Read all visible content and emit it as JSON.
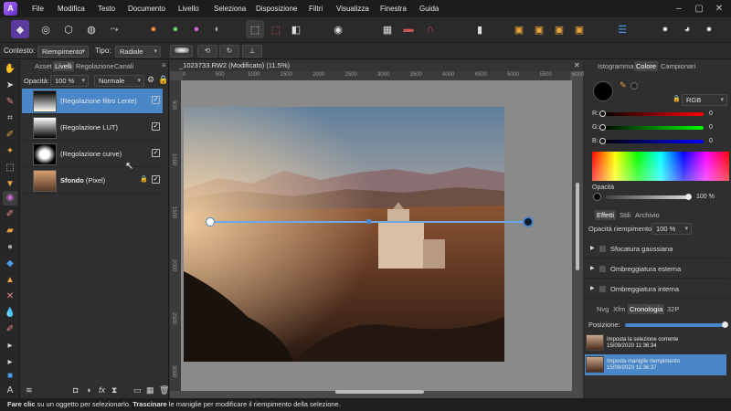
{
  "menubar": {
    "items": [
      "File",
      "Modifica",
      "Testo",
      "Documento",
      "Livello",
      "Seleziona",
      "Disposizione",
      "Filtri",
      "Visualizza",
      "Finestra",
      "Guida"
    ]
  },
  "context": {
    "context_label": "Contesto:",
    "context_value": "Riempimento",
    "type_label": "Tipo:",
    "type_value": "Radiale"
  },
  "layers_panel": {
    "tabs": [
      "Asset",
      "Livelli",
      "Regolazione",
      "Canali"
    ],
    "opacity_label": "Opacità:",
    "opacity_value": "100 %",
    "blend_mode": "Normale",
    "layers": [
      {
        "name": "(Regolazione filtro Lente)"
      },
      {
        "name": "(Regolazione LUT)"
      },
      {
        "name": "(Regolazione curve)"
      },
      {
        "name": "Sfondo",
        "suffix": "(Pixel)"
      }
    ]
  },
  "document": {
    "tab_title": "_1023733.RW2 (Modificato) (11.5%)",
    "ruler_h": [
      "0",
      "500",
      "1000",
      "1500",
      "2000",
      "2500",
      "3000",
      "3500",
      "4000",
      "4500",
      "5000",
      "5500",
      "6000"
    ],
    "ruler_v": [
      "500",
      "1000",
      "1500",
      "2000",
      "2500",
      "3000"
    ]
  },
  "right_panel": {
    "top_tabs": [
      "Istogramma",
      "Colore",
      "Campionari"
    ],
    "color_model": "RGB",
    "channels": [
      {
        "label": "R:",
        "value": "0"
      },
      {
        "label": "G:",
        "value": "0"
      },
      {
        "label": "B:",
        "value": "0"
      }
    ],
    "opacity_label": "Opacità",
    "opacity_value": "100 %",
    "effects_tabs": [
      "Effetti",
      "Stili",
      "Archivio"
    ],
    "fill_opacity_label": "Opacità riempimento:",
    "fill_opacity_value": "100 %",
    "effects": [
      "Sfocatura gaussiana",
      "Ombreggiatura esterna",
      "Ombreggiatura interna"
    ],
    "history_tabs": [
      "Nvg",
      "Xfm",
      "Cronologia",
      "32P"
    ],
    "position_label": "Posizione:",
    "history": [
      {
        "title": "Imposta la selezione corrente",
        "time": "15/09/2020 11:36:34"
      },
      {
        "title": "Imposta maniglie riempimento",
        "time": "15/09/2020 11:36:37"
      }
    ]
  },
  "status": {
    "bold1": "Fare clic",
    "text1": " su un oggetto per selezionarlo. ",
    "bold2": "Trascinare",
    "text2": " le maniglie per modificare il riempimento della selezione."
  },
  "colors": {
    "accent": "#4a87c9",
    "menubar": "#1c1c1c",
    "panel": "#2f2f2f"
  }
}
